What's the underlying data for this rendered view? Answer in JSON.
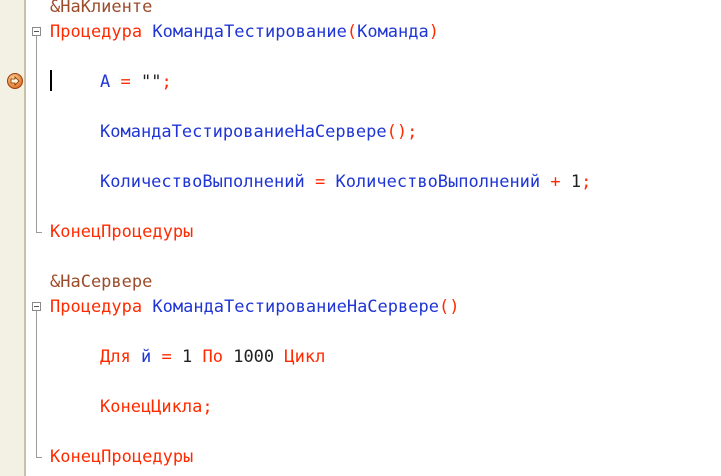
{
  "editor": {
    "lines": {
      "l1": {
        "text": "&НаКлиенте"
      },
      "l2": {
        "kw": "Процедура",
        "name": "КомандаТестирование",
        "open": "(",
        "param": "Команда",
        "close": ")"
      },
      "l3": {
        "var": "А",
        "eq": "=",
        "str": "\"\"",
        "semi": ";"
      },
      "l4": {
        "call": "КомандаТестированиеНаСервере",
        "parens": "()",
        "semi": ";"
      },
      "l5": {
        "lhs": "КоличествоВыполнений",
        "eq": "=",
        "rhs": "КоличествоВыполнений",
        "plus": "+",
        "num": "1",
        "semi": ";"
      },
      "l6": {
        "text": "КонецПроцедуры"
      },
      "l7": {
        "text": "&НаСервере"
      },
      "l8": {
        "kw": "Процедура",
        "name": "КомандаТестированиеНаСервере",
        "parens": "()"
      },
      "l9": {
        "kw_for": "Для",
        "var": "й",
        "eq": "=",
        "from": "1",
        "kw_to": "По",
        "to": "1000",
        "kw_loop": "Цикл"
      },
      "l10": {
        "kw": "КонецЦикла",
        "semi": ";"
      },
      "l11": {
        "text": "КонецПроцедуры"
      }
    },
    "icons": {
      "breakpoint": "current-line-breakpoint-icon",
      "fold": "fold-toggle-icon"
    },
    "colors": {
      "keyword": "#ff2a00",
      "identifier": "#1f35d4",
      "preprocessor": "#9b4c2b",
      "gutter": "#f3f0e4"
    }
  }
}
